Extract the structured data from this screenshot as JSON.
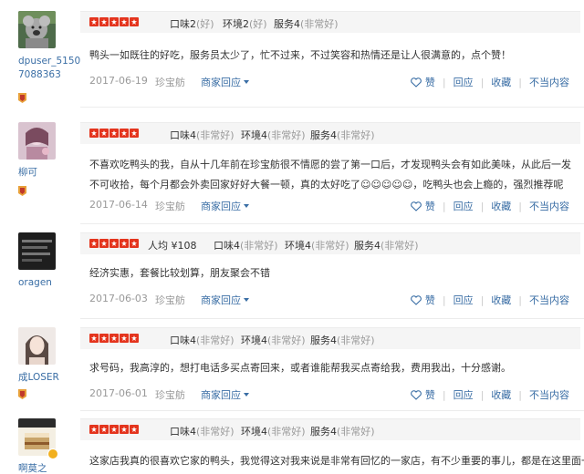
{
  "reviews": [
    {
      "username": "dpuser_51507088363",
      "scores": [
        {
          "label": "口味2",
          "qual": "(好)"
        },
        {
          "label": "环境2",
          "qual": "(好)"
        },
        {
          "label": "服务4",
          "qual": "(非常好)"
        }
      ],
      "price": null,
      "content": "鸭头一如既往的好吃，服务员太少了，忙不过来，不过笑容和热情还是让人很满意的，点个赞！",
      "date": "2017-06-19",
      "shop": "珍宝舫",
      "merchant_reply": "商家回应",
      "actions": {
        "like": "赞",
        "reply": "回应",
        "favorite": "收藏",
        "report": "不当内容"
      }
    },
    {
      "username": "柳可",
      "scores": [
        {
          "label": "口味4",
          "qual": "(非常好)"
        },
        {
          "label": "环境4",
          "qual": "(非常好)"
        },
        {
          "label": "服务4",
          "qual": "(非常好)"
        }
      ],
      "price": null,
      "content": "不喜欢吃鸭头的我，自从十几年前在珍宝舫很不情愿的尝了第一口后，才发现鸭头会有如此美味，从此后一发不可收拾，每个月都会外卖回家好好大餐一顿，真的太好吃了☺☺☺☺☺，吃鸭头也会上瘾的，强烈推荐呢",
      "date": "2017-06-14",
      "shop": "珍宝舫",
      "merchant_reply": "商家回应",
      "actions": {
        "like": "赞",
        "reply": "回应",
        "favorite": "收藏",
        "report": "不当内容"
      }
    },
    {
      "username": "oragen",
      "scores": [
        {
          "label": "口味4",
          "qual": "(非常好)"
        },
        {
          "label": "环境4",
          "qual": "(非常好)"
        },
        {
          "label": "服务4",
          "qual": "(非常好)"
        }
      ],
      "price": "人均 ¥108",
      "content": "经济实惠，套餐比较划算，朋友聚会不错",
      "date": "2017-06-03",
      "shop": "珍宝舫",
      "merchant_reply": "商家回应",
      "actions": {
        "like": "赞",
        "reply": "回应",
        "favorite": "收藏",
        "report": "不当内容"
      }
    },
    {
      "username": "成LOSER",
      "scores": [
        {
          "label": "口味4",
          "qual": "(非常好)"
        },
        {
          "label": "环境4",
          "qual": "(非常好)"
        },
        {
          "label": "服务4",
          "qual": "(非常好)"
        }
      ],
      "price": null,
      "content": "求号码，我高淳的，想打电话多买点寄回来，或者谁能帮我买点寄给我，费用我出，十分感谢。",
      "date": "2017-06-01",
      "shop": "珍宝舫",
      "merchant_reply": "商家回应",
      "actions": {
        "like": "赞",
        "reply": "回应",
        "favorite": "收藏",
        "report": "不当内容"
      }
    },
    {
      "username": "啊莫之",
      "scores": [
        {
          "label": "口味4",
          "qual": "(非常好)"
        },
        {
          "label": "环境4",
          "qual": "(非常好)"
        },
        {
          "label": "服务4",
          "qual": "(非常好)"
        }
      ],
      "price": null,
      "content": "这家店我真的很喜欢它家的鸭头，我觉得这对我来说是非常有回忆的一家店，有不少重要的事儿，都是在这里面一",
      "date": "",
      "shop": "",
      "merchant_reply": "",
      "actions": {
        "like": "",
        "reply": "",
        "favorite": "",
        "report": ""
      }
    }
  ],
  "colors": {
    "stars": "#e4341d",
    "link": "#3a6ea5",
    "muted": "#999999",
    "medal": "#e8a03a"
  },
  "icons": {
    "like": "heart-outline-icon",
    "merchant_reply": "triangle-down-icon",
    "medal": "medal-icon",
    "rating": "star-icon"
  }
}
